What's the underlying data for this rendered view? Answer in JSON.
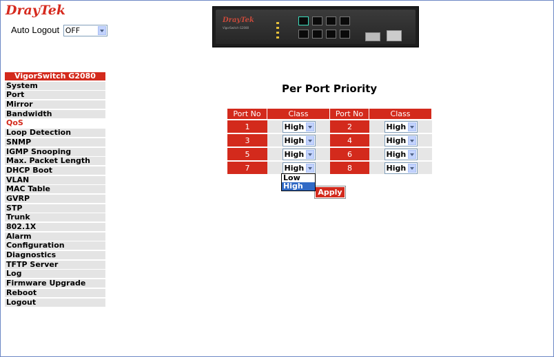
{
  "header": {
    "logo_text": "DrayTek",
    "auto_logout_label": "Auto Logout",
    "auto_logout_value": "OFF"
  },
  "device": {
    "brand": "DrayTek",
    "model": "VigorSwitch G2080"
  },
  "sidebar": {
    "title": "VigorSwitch G2080",
    "items": [
      {
        "label": "System"
      },
      {
        "label": "Port"
      },
      {
        "label": "Mirror"
      },
      {
        "label": "Bandwidth"
      },
      {
        "label": "QoS"
      },
      {
        "label": "Loop Detection"
      },
      {
        "label": "SNMP"
      },
      {
        "label": "IGMP Snooping"
      },
      {
        "label": "Max. Packet Length"
      },
      {
        "label": "DHCP Boot"
      },
      {
        "label": "VLAN"
      },
      {
        "label": "MAC Table"
      },
      {
        "label": "GVRP"
      },
      {
        "label": "STP"
      },
      {
        "label": "Trunk"
      },
      {
        "label": "802.1X"
      },
      {
        "label": "Alarm"
      },
      {
        "label": "Configuration"
      },
      {
        "label": "Diagnostics"
      },
      {
        "label": "TFTP Server"
      },
      {
        "label": "Log"
      },
      {
        "label": "Firmware Upgrade"
      },
      {
        "label": "Reboot"
      },
      {
        "label": "Logout"
      }
    ],
    "active": "QoS"
  },
  "main": {
    "title": "Per Port Priority",
    "headers": [
      "Port No",
      "Class",
      "Port No",
      "Class"
    ],
    "rows": [
      {
        "port_a": "1",
        "class_a": "High",
        "port_b": "2",
        "class_b": "High"
      },
      {
        "port_a": "3",
        "class_a": "High",
        "port_b": "4",
        "class_b": "High"
      },
      {
        "port_a": "5",
        "class_a": "High",
        "port_b": "6",
        "class_b": "High"
      },
      {
        "port_a": "7",
        "class_a": "High",
        "port_b": "8",
        "class_b": "High"
      }
    ],
    "dropdown_options": [
      "Low",
      "High"
    ],
    "dropdown_selected": "High",
    "apply_label": "Apply"
  },
  "colors": {
    "brand_red": "#d32a1c",
    "selection_blue": "#316ac5"
  }
}
